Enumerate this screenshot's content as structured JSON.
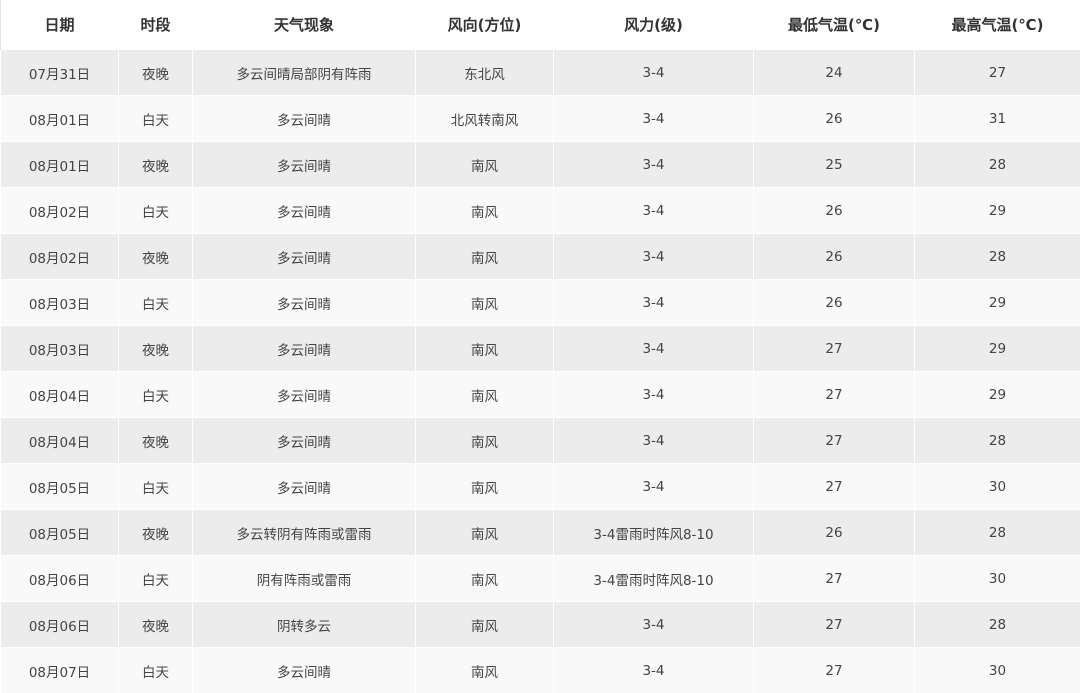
{
  "table": {
    "headers": [
      "日期",
      "时段",
      "天气现象",
      "风向(方位)",
      "风力(级)",
      "最低气温(℃)",
      "最高气温(℃)"
    ],
    "rows": [
      [
        "07月31日",
        "夜晚",
        "多云间晴局部阴有阵雨",
        "东北风",
        "3-4",
        "24",
        "27"
      ],
      [
        "08月01日",
        "白天",
        "多云间晴",
        "北风转南风",
        "3-4",
        "26",
        "31"
      ],
      [
        "08月01日",
        "夜晚",
        "多云间晴",
        "南风",
        "3-4",
        "25",
        "28"
      ],
      [
        "08月02日",
        "白天",
        "多云间晴",
        "南风",
        "3-4",
        "26",
        "29"
      ],
      [
        "08月02日",
        "夜晚",
        "多云间晴",
        "南风",
        "3-4",
        "26",
        "28"
      ],
      [
        "08月03日",
        "白天",
        "多云间晴",
        "南风",
        "3-4",
        "26",
        "29"
      ],
      [
        "08月03日",
        "夜晚",
        "多云间晴",
        "南风",
        "3-4",
        "27",
        "29"
      ],
      [
        "08月04日",
        "白天",
        "多云间晴",
        "南风",
        "3-4",
        "27",
        "29"
      ],
      [
        "08月04日",
        "夜晚",
        "多云间晴",
        "南风",
        "3-4",
        "27",
        "28"
      ],
      [
        "08月05日",
        "白天",
        "多云间晴",
        "南风",
        "3-4",
        "27",
        "30"
      ],
      [
        "08月05日",
        "夜晚",
        "多云转阴有阵雨或雷雨",
        "南风",
        "3-4雷雨时阵风8-10",
        "26",
        "28"
      ],
      [
        "08月06日",
        "白天",
        "阴有阵雨或雷雨",
        "南风",
        "3-4雷雨时阵风8-10",
        "27",
        "30"
      ],
      [
        "08月06日",
        "夜晚",
        "阴转多云",
        "南风",
        "3-4",
        "27",
        "28"
      ],
      [
        "08月07日",
        "白天",
        "多云间晴",
        "南风",
        "3-4",
        "27",
        "30"
      ]
    ]
  }
}
